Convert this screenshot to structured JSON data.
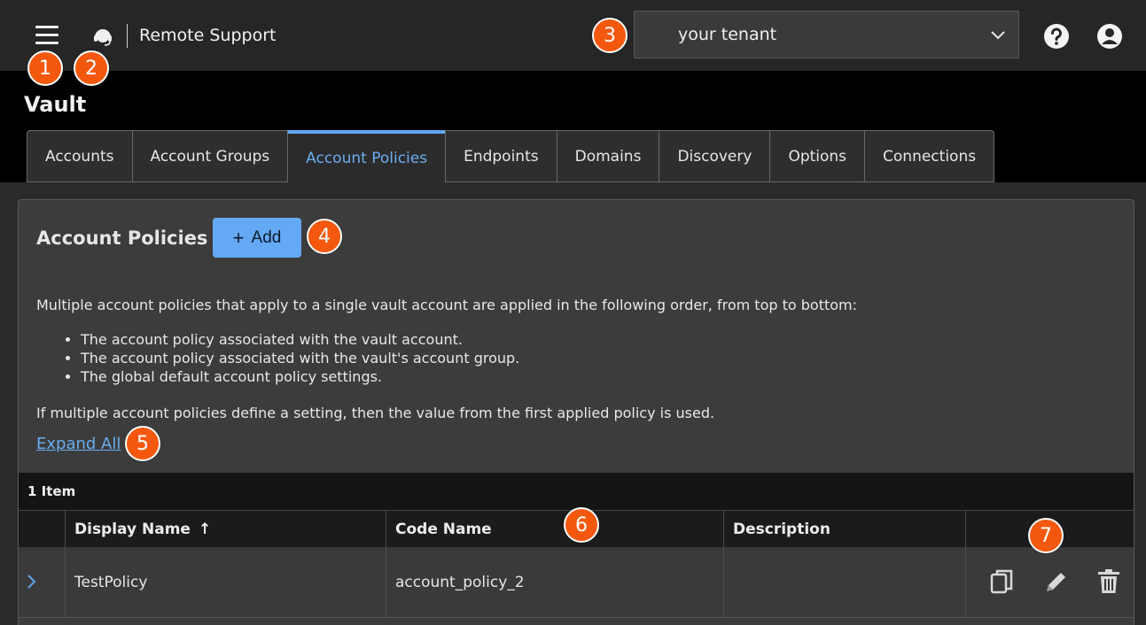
{
  "topbar": {
    "app_title": "Remote Support",
    "tenant_value": "your tenant",
    "icons": {
      "menu": "hamburger-menu-icon",
      "app": "headset-icon",
      "help": "help-icon",
      "user": "user-account-icon"
    }
  },
  "vault": {
    "title": "Vault",
    "tabs": [
      {
        "label": "Accounts"
      },
      {
        "label": "Account Groups"
      },
      {
        "label": "Account Policies"
      },
      {
        "label": "Endpoints"
      },
      {
        "label": "Domains"
      },
      {
        "label": "Discovery"
      },
      {
        "label": "Options"
      },
      {
        "label": "Connections"
      }
    ],
    "active_tab": "Account Policies"
  },
  "panel": {
    "title": "Account Policies",
    "add_label": "Add",
    "description": "Multiple account policies that apply to a single vault account are applied in the following order, from top to bottom:",
    "bullets": [
      "The account policy associated with the vault account.",
      "The account policy associated with the vault's account group.",
      "The global default account policy settings."
    ],
    "note": "If multiple account policies define a setting, then the value from the first applied policy is used.",
    "expand_all": "Expand All"
  },
  "table": {
    "count_label": "1 Item",
    "columns": [
      "Display Name",
      "Code Name",
      "Description"
    ],
    "sort_indicator": "↑",
    "rows": [
      {
        "display_name": "TestPolicy",
        "code_name": "account_policy_2",
        "description": ""
      }
    ]
  },
  "callouts": [
    "1",
    "2",
    "3",
    "4",
    "5",
    "6",
    "7"
  ],
  "colors": {
    "accent": "#64a9f4",
    "callout": "#f4580f",
    "topbar": "#262626",
    "header": "#000000",
    "panel": "#3c3c3c"
  }
}
